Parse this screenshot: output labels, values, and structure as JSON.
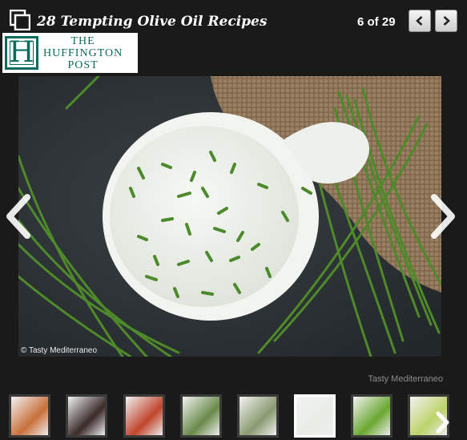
{
  "header": {
    "title": "28 Tempting Olive Oil Recipes",
    "counter_current": "6",
    "counter_of": "of",
    "counter_total": "29"
  },
  "logo": {
    "letter": "H",
    "line1": "THE",
    "line2": "HUFFINGTON",
    "line3": "POST"
  },
  "photo": {
    "subject": "bowl-of-chive-dip",
    "copyright": "© Tasty Mediterraneo"
  },
  "source_credit": "Tasty Mediterraneo",
  "thumbnails": [
    {
      "name": "thumb-1",
      "active": false,
      "color": "#c9703a"
    },
    {
      "name": "thumb-2",
      "active": false,
      "color": "#3a2a2a"
    },
    {
      "name": "thumb-3",
      "active": false,
      "color": "#c0452c"
    },
    {
      "name": "thumb-4",
      "active": false,
      "color": "#6a8a4a"
    },
    {
      "name": "thumb-5",
      "active": false,
      "color": "#8a9a70"
    },
    {
      "name": "thumb-6",
      "active": true,
      "color": "#e8ede6"
    },
    {
      "name": "thumb-7",
      "active": false,
      "color": "#6aa832"
    },
    {
      "name": "thumb-8",
      "active": false,
      "color": "#bcd36a"
    }
  ],
  "colors": {
    "background": "#1a1a1a",
    "logo_green": "#0a6c5c"
  }
}
